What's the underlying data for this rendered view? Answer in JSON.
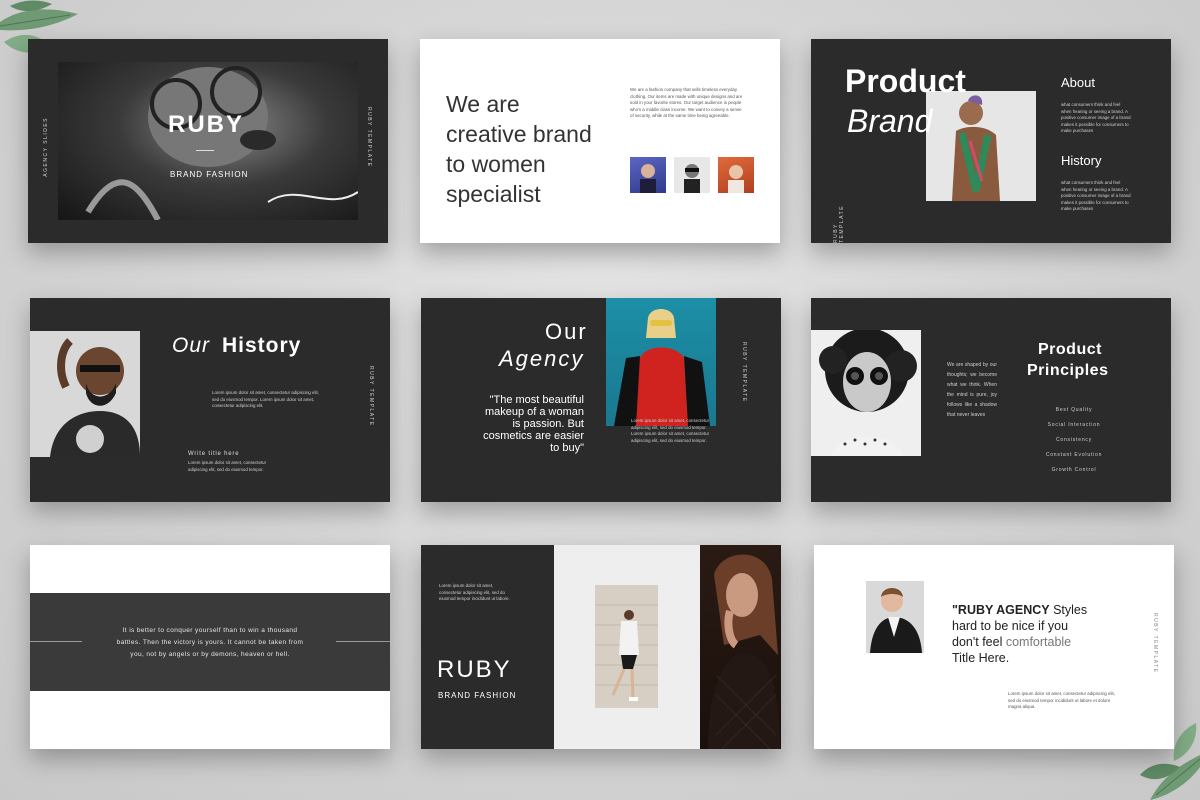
{
  "colors": {
    "background": "#d4d4d4",
    "slide_dark": "#2b2b2b",
    "slide_light": "#ffffff",
    "band": "#3a3a3a"
  },
  "s1": {
    "title": "RUBY",
    "subtitle": "BRAND FASHION",
    "side_left": "AGENCY SLIDES",
    "side_right": "RUBY TEMPLATE"
  },
  "s2": {
    "heading_l1": "We are",
    "heading_l2": "creative brand",
    "heading_l3": "to women",
    "heading_l4": "specialist",
    "body": "We are a fashion company that sells timeless everyday clothing. Our items are made with unique designs and are sold in your favorite stores. Our target audience is people who's a middle class income. We want to convey a sense of security, while at the same time being agreeable."
  },
  "s3": {
    "title_l1": "Product",
    "title_l2": "Brand",
    "about_title": "About",
    "about_body": "what consumers think and feel when hearing or seeing a brand. A positive consumer image of a brand makes it possible for consumers to make purchases",
    "history_title": "History",
    "history_body": "what consumers think and feel when hearing or seeing a brand. A positive consumer image of a brand makes it possible for consumers to make purchases",
    "side": "RUBY TEMPLATE"
  },
  "s4": {
    "title_italic": "Our",
    "title_bold": "History",
    "body": "Lorem ipsum dolor sit amet, consectetur adipiscing elit, sed do eiusmod tempor. Lorem ipsum dolor sit amet, consectetur adipiscing elit.",
    "subtitle": "Write title here",
    "sub_body": "Lorem ipsum dolor sit amet, consectetur adipiscing elit, sed do eiusmod tempor.",
    "side": "RUBY TEMPLATE"
  },
  "s5": {
    "title_l1": "Our",
    "title_l2": "Agency",
    "quote_l1": "\"The most beautiful",
    "quote_l2": "makeup of a woman",
    "quote_l3": "is passion. But",
    "quote_l4": "cosmetics are easier",
    "quote_l5": "to buy\"",
    "body": "Lorem ipsum dolor sit amet, consectetur adipiscing elit, sed do eiusmod tempor. Lorem ipsum dolor sit amet, consectetur adipiscing elit, sed do eiusmod tempor.",
    "side": "RUBY TEMPLATE"
  },
  "s6": {
    "title_l1": "Product",
    "title_l2": "Principles",
    "body": "We are shaped by our thoughts; we become what we think. When the mind is pure, joy follows like a shadow that never leaves",
    "items": [
      "Best Quality",
      "Social Interaction",
      "Consistency",
      "Constant Evolution",
      "Growth Control"
    ]
  },
  "s7": {
    "quote": "It is better to conquer yourself than to win a thousand battles. Then the victory is yours. It cannot be taken from you, not by angels or by demons, heaven or hell."
  },
  "s8": {
    "title": "RUBY",
    "subtitle": "BRAND FASHION",
    "body": "Lorem ipsum dolor sit amet, consectetur adipiscing elit, sed do eiusmod tempor incididunt ut labore."
  },
  "s9": {
    "quote_bold": "\"RUBY AGENCY",
    "quote_rest_1": " Styles",
    "quote_l2": "hard to be nice if you",
    "quote_l3a": "don't feel ",
    "quote_l3b": "comfortable",
    "quote_l4": "Title Here.",
    "body": "Lorem ipsum dolor sit amet, consectetur adipiscing elit, sed do eiusmod tempor incididunt ut labore et dolore magna aliqua.",
    "side": "RUBY TEMPLATE"
  }
}
